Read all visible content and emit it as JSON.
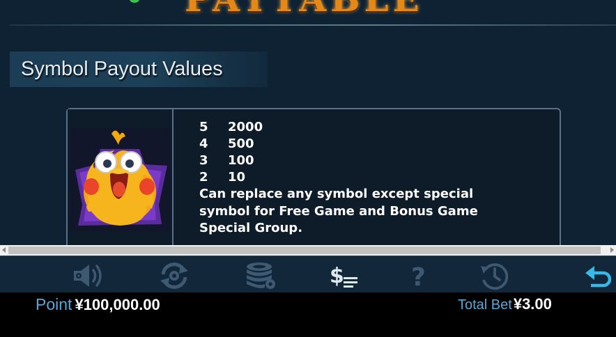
{
  "header": {
    "title": "PAYTABLE"
  },
  "section": {
    "title": "Symbol Payout Values"
  },
  "symbol_card": {
    "symbol_icon": "yellow-chick-wild-symbol",
    "payouts": [
      {
        "count": "5",
        "value": "2000"
      },
      {
        "count": "4",
        "value": "500"
      },
      {
        "count": "3",
        "value": "100"
      },
      {
        "count": "2",
        "value": "10"
      }
    ],
    "description": "Can replace any symbol except special symbol for Free Game and Bonus Game Special Group."
  },
  "toolbar": {
    "buttons": [
      {
        "icon": "speaker-icon",
        "active": false
      },
      {
        "icon": "autoplay-icon",
        "active": false
      },
      {
        "icon": "coins-settings-icon",
        "active": false
      },
      {
        "icon": "paytable-icon",
        "active": true
      },
      {
        "icon": "help-icon",
        "active": false
      },
      {
        "icon": "history-icon",
        "active": false
      },
      {
        "icon": "back-icon",
        "active": true
      }
    ]
  },
  "status": {
    "point_label": "Point",
    "point_value": "¥100,000.00",
    "total_bet_label": "Total Bet",
    "total_bet_value": "¥3.00"
  },
  "colors": {
    "background": "#0f2233",
    "toolbar": "#12273a",
    "accent_blue": "#5aa7d6",
    "back_button": "#39b8e8",
    "card_border": "#5a6f8d",
    "title_orange": "#e48818"
  }
}
